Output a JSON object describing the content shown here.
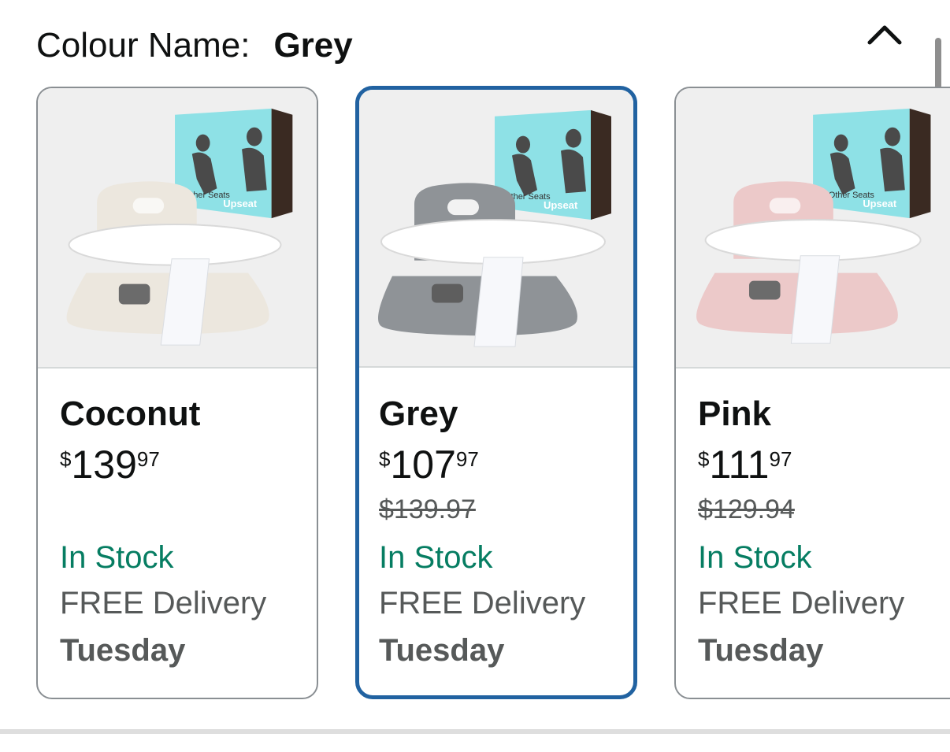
{
  "header": {
    "label": "Colour Name:",
    "selected": "Grey"
  },
  "box_text": {
    "left": "Other Seats",
    "right": "Upseat"
  },
  "variants": [
    {
      "name": "Coconut",
      "price_symbol": "$",
      "price_whole": "139",
      "price_fraction": "97",
      "was_price": "",
      "stock": "In Stock",
      "delivery": "FREE Delivery",
      "delivery_day": "Tuesday",
      "seat_color": "#ece7de",
      "selected": false
    },
    {
      "name": "Grey",
      "price_symbol": "$",
      "price_whole": "107",
      "price_fraction": "97",
      "was_price": "$139.97",
      "stock": "In Stock",
      "delivery": "FREE Delivery",
      "delivery_day": "Tuesday",
      "seat_color": "#8f9397",
      "selected": true
    },
    {
      "name": "Pink",
      "price_symbol": "$",
      "price_whole": "111",
      "price_fraction": "97",
      "was_price": "$129.94",
      "stock": "In Stock",
      "delivery": "FREE Delivery",
      "delivery_day": "Tuesday",
      "seat_color": "#ecc9c9",
      "selected": false
    }
  ],
  "colors": {
    "selected_border": "#2162a1",
    "stock_green": "#067d62",
    "box_teal": "#8ee1e6"
  },
  "icons": {
    "collapse": "chevron-up-icon"
  }
}
